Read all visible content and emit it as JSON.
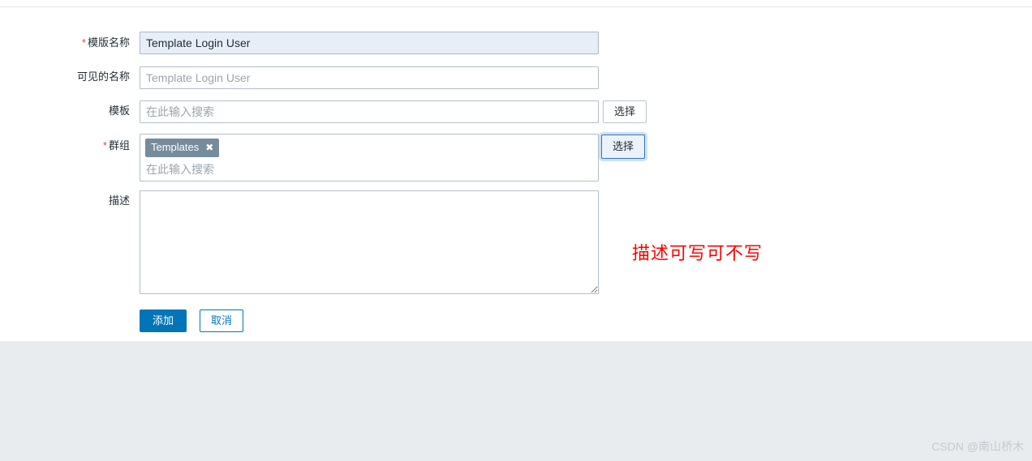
{
  "form": {
    "rows": [
      {
        "label": "模版名称",
        "required": true,
        "value": "Template Login User",
        "placeholder": ""
      },
      {
        "label": "可见的名称",
        "required": false,
        "value": "",
        "placeholder": "Template Login User"
      },
      {
        "label": "模板",
        "required": false,
        "value": "",
        "placeholder": "在此输入搜索",
        "select_button": "选择"
      },
      {
        "label": "群组",
        "required": true,
        "chip": "Templates",
        "chip_close_icon": "close-x-icon",
        "placeholder": "在此输入搜索",
        "select_button": "选择"
      },
      {
        "label": "描述",
        "required": false,
        "value": "",
        "placeholder": ""
      }
    ],
    "required_marker": "*",
    "actions": {
      "submit_label": "添加",
      "cancel_label": "取消"
    }
  },
  "annotation": {
    "text": "描述可写可不写",
    "color": "#ff0000"
  },
  "watermark": {
    "text": "CSDN @南山桥木"
  },
  "colors": {
    "accent": "#0275b8",
    "focus_border": "#3775b5",
    "focus_glow": "#cfe0f3",
    "chip_bg": "#768b9b",
    "input_border": "#b0bfc9",
    "highlight_bg": "#e8eef8",
    "footer_bg": "#e9ecef",
    "required_star": "#d64e4e"
  }
}
